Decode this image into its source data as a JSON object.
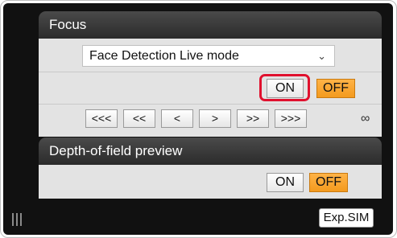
{
  "focus": {
    "title": "Focus",
    "mode_select": {
      "value": "Face Detection Live mode",
      "chevron": "chevron-down-icon"
    },
    "toggle": {
      "on_label": "ON",
      "off_label": "OFF",
      "selected": "OFF"
    },
    "nav_buttons": [
      "<<<",
      "<<",
      "<",
      ">",
      ">>",
      ">>>"
    ],
    "infinity_symbol": "∞"
  },
  "depth_preview": {
    "title": "Depth-of-field preview",
    "toggle": {
      "on_label": "ON",
      "off_label": "OFF",
      "selected": "OFF"
    }
  },
  "footer": {
    "exp_sim_label": "Exp.SIM",
    "grip_icon": "grip-icon"
  },
  "colors": {
    "panel_bg": "#111111",
    "section_bg": "#e3e3e3",
    "header_top": "#4a4a4a",
    "active_orange": "#f39a1e",
    "highlight_red": "#e0112e"
  }
}
